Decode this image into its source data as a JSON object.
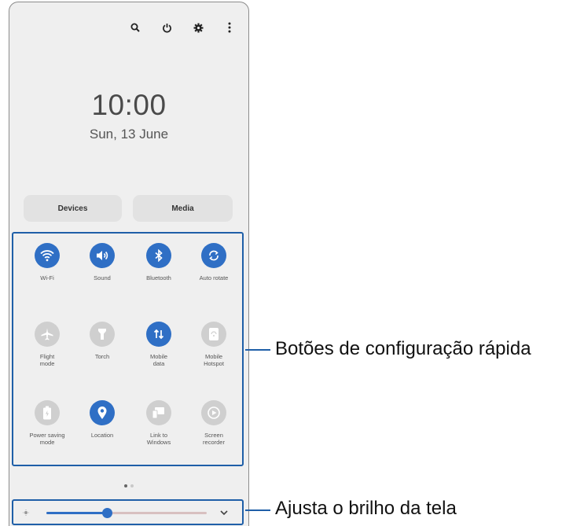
{
  "status_bar": {
    "icons": [
      "search-icon",
      "power-icon",
      "gear-icon",
      "more-vertical-icon"
    ]
  },
  "clock": {
    "time": "10:00",
    "date": "Sun, 13 June"
  },
  "pills": {
    "devices": "Devices",
    "media": "Media"
  },
  "quick_settings": [
    {
      "label": "Wi-Fi",
      "icon": "wifi-icon",
      "active": true
    },
    {
      "label": "Sound",
      "icon": "sound-icon",
      "active": true
    },
    {
      "label": "Bluetooth",
      "icon": "bluetooth-icon",
      "active": true
    },
    {
      "label": "Auto rotate",
      "icon": "auto-rotate-icon",
      "active": true
    },
    {
      "label": "Flight\nmode",
      "icon": "airplane-icon",
      "active": false
    },
    {
      "label": "Torch",
      "icon": "torch-icon",
      "active": false
    },
    {
      "label": "Mobile\ndata",
      "icon": "mobile-data-icon",
      "active": true
    },
    {
      "label": "Mobile\nHotspot",
      "icon": "hotspot-icon",
      "active": false
    },
    {
      "label": "Power saving\nmode",
      "icon": "battery-icon",
      "active": false
    },
    {
      "label": "Location",
      "icon": "location-icon",
      "active": true
    },
    {
      "label": "Link to\nWindows",
      "icon": "link-windows-icon",
      "active": false
    },
    {
      "label": "Screen\nrecorder",
      "icon": "screen-recorder-icon",
      "active": false
    }
  ],
  "page_indicator": {
    "pages": 2,
    "current": 1
  },
  "brightness": {
    "level": 0.38
  },
  "callouts": {
    "quick_settings": "Botões de configuração rápida",
    "brightness": "Ajusta o brilho da tela"
  },
  "colors": {
    "accent": "#2f6fc5",
    "highlight_border": "#1f5fa8",
    "tile_inactive": "#cfcfcf",
    "panel_background": "#efefef"
  }
}
